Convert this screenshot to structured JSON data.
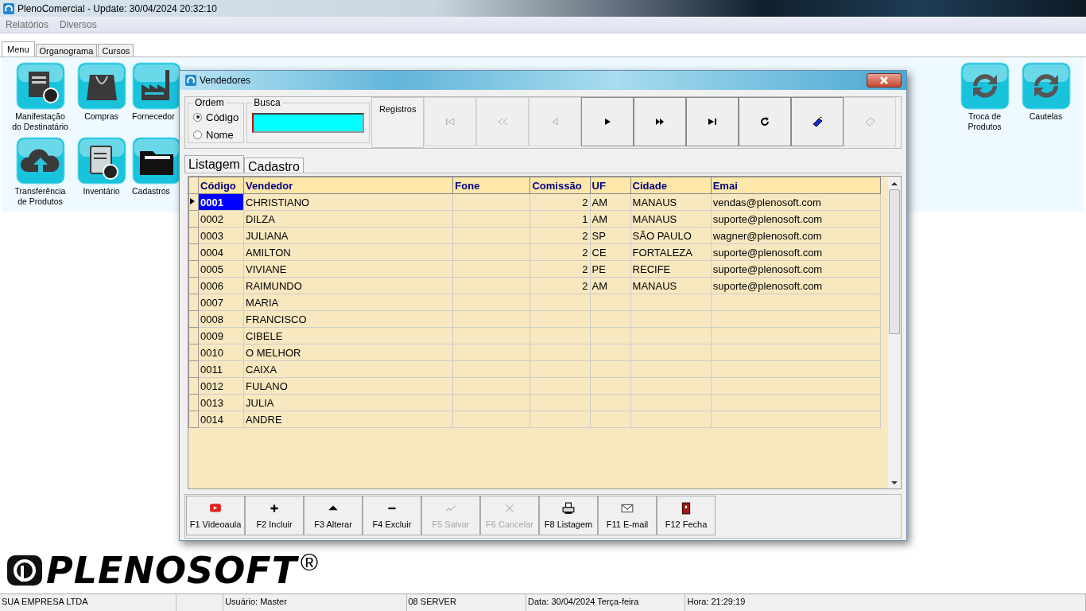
{
  "window": {
    "title": "PlenoComercial - Update: 30/04/2024 20:32:10"
  },
  "menu_bar": [
    "Relatórios",
    "Diversos"
  ],
  "tabs": [
    {
      "label": "Menu",
      "selected": true
    },
    {
      "label": "Organograma",
      "selected": false
    },
    {
      "label": "Cursos",
      "selected": false
    }
  ],
  "tiles_left": [
    {
      "label": "Manifestação\ndo Destinatário",
      "kind": "document"
    },
    {
      "label": "Compras",
      "kind": "bag"
    },
    {
      "label": "Fornecedor",
      "kind": "factory"
    },
    {
      "label": "Transferência\nde Produtos",
      "kind": "cloud"
    },
    {
      "label": "Inventário",
      "kind": "clipboard"
    },
    {
      "label": "Cadastros",
      "kind": "folder"
    }
  ],
  "tiles_right": [
    {
      "label": "Troca de\nProdutos",
      "kind": "sync"
    },
    {
      "label": "Cautelas",
      "kind": "sync"
    }
  ],
  "logo": {
    "text": "PLENOSOFT",
    "mark": "®"
  },
  "dialog": {
    "title": "Vendedores",
    "ordem": {
      "label": "Ordem",
      "options": [
        {
          "label": "Código",
          "selected": true
        },
        {
          "label": "Nome",
          "selected": false
        }
      ]
    },
    "busca": {
      "label": "Busca"
    },
    "registros": "Registros",
    "nav_buttons": [
      {
        "kind": "first",
        "disabled": true
      },
      {
        "kind": "prior",
        "disabled": true
      },
      {
        "kind": "previous",
        "disabled": true
      },
      {
        "kind": "next",
        "disabled": false
      },
      {
        "kind": "forward",
        "disabled": false
      },
      {
        "kind": "last",
        "disabled": false
      },
      {
        "kind": "refresh",
        "disabled": false
      },
      {
        "kind": "edit",
        "disabled": false
      },
      {
        "kind": "goto",
        "disabled": true
      }
    ],
    "tabs": [
      {
        "label": "Listagem",
        "selected": true
      },
      {
        "label": "Cadastro",
        "selected": false
      }
    ],
    "table": {
      "columns": [
        "Código",
        "Vendedor",
        "Fone",
        "Comissão",
        "UF",
        "Cidade",
        "Emai"
      ],
      "rows": [
        {
          "selected": true,
          "cells": [
            "0001",
            "CHRISTIANO",
            "",
            "2",
            "AM",
            "MANAUS",
            "vendas@plenosoft.com"
          ]
        },
        {
          "selected": false,
          "cells": [
            "0002",
            "DILZA",
            "",
            "1",
            "AM",
            "MANAUS",
            "suporte@plenosoft.com"
          ]
        },
        {
          "selected": false,
          "cells": [
            "0003",
            "JULIANA",
            "",
            "2",
            "SP",
            "SÃO PAULO",
            "wagner@plenosoft.com"
          ]
        },
        {
          "selected": false,
          "cells": [
            "0004",
            "AMILTON",
            "",
            "2",
            "CE",
            "FORTALEZA",
            "suporte@plenosoft.com"
          ]
        },
        {
          "selected": false,
          "cells": [
            "0005",
            "VIVIANE",
            "",
            "2",
            "PE",
            "RECIFE",
            "suporte@plenosoft.com"
          ]
        },
        {
          "selected": false,
          "cells": [
            "0006",
            "RAIMUNDO",
            "",
            "2",
            "AM",
            "MANAUS",
            "suporte@plenosoft.com"
          ]
        },
        {
          "selected": false,
          "cells": [
            "0007",
            "MARIA",
            "",
            "",
            "",
            "",
            ""
          ]
        },
        {
          "selected": false,
          "cells": [
            "0008",
            "FRANCISCO",
            "",
            "",
            "",
            "",
            ""
          ]
        },
        {
          "selected": false,
          "cells": [
            "0009",
            "CIBELE",
            "",
            "",
            "",
            "",
            ""
          ]
        },
        {
          "selected": false,
          "cells": [
            "0010",
            "O MELHOR",
            "",
            "",
            "",
            "",
            ""
          ]
        },
        {
          "selected": false,
          "cells": [
            "0011",
            "CAIXA",
            "",
            "",
            "",
            "",
            ""
          ]
        },
        {
          "selected": false,
          "cells": [
            "0012",
            "FULANO",
            "",
            "",
            "",
            "",
            ""
          ]
        },
        {
          "selected": false,
          "cells": [
            "0013",
            "JULIA",
            "",
            "",
            "",
            "",
            ""
          ]
        },
        {
          "selected": false,
          "cells": [
            "0014",
            "ANDRE",
            "",
            "",
            "",
            "",
            ""
          ]
        }
      ]
    },
    "buttons": [
      {
        "label": "F1 Videoaula",
        "kind": "video",
        "disabled": false
      },
      {
        "label": "F2 Incluir",
        "kind": "plus",
        "disabled": false
      },
      {
        "label": "F3 Alterar",
        "kind": "up",
        "disabled": false
      },
      {
        "label": "F4 Excluir",
        "kind": "minus",
        "disabled": false
      },
      {
        "label": "F5 Salvar",
        "kind": "check",
        "disabled": true
      },
      {
        "label": "F6 Cancelar",
        "kind": "cross",
        "disabled": true
      },
      {
        "label": "F8 Listagem",
        "kind": "printer",
        "disabled": false
      },
      {
        "label": "F11 E-mail",
        "kind": "mail",
        "disabled": false
      },
      {
        "label": "F12 Fecha",
        "kind": "door",
        "disabled": false
      }
    ]
  },
  "status_bar": [
    "SUA EMPRESA LTDA",
    "Usuário: Master",
    "08 SERVER",
    "Data: 30/04/2024 Terça-feira",
    "Hora: 21:29:19"
  ]
}
